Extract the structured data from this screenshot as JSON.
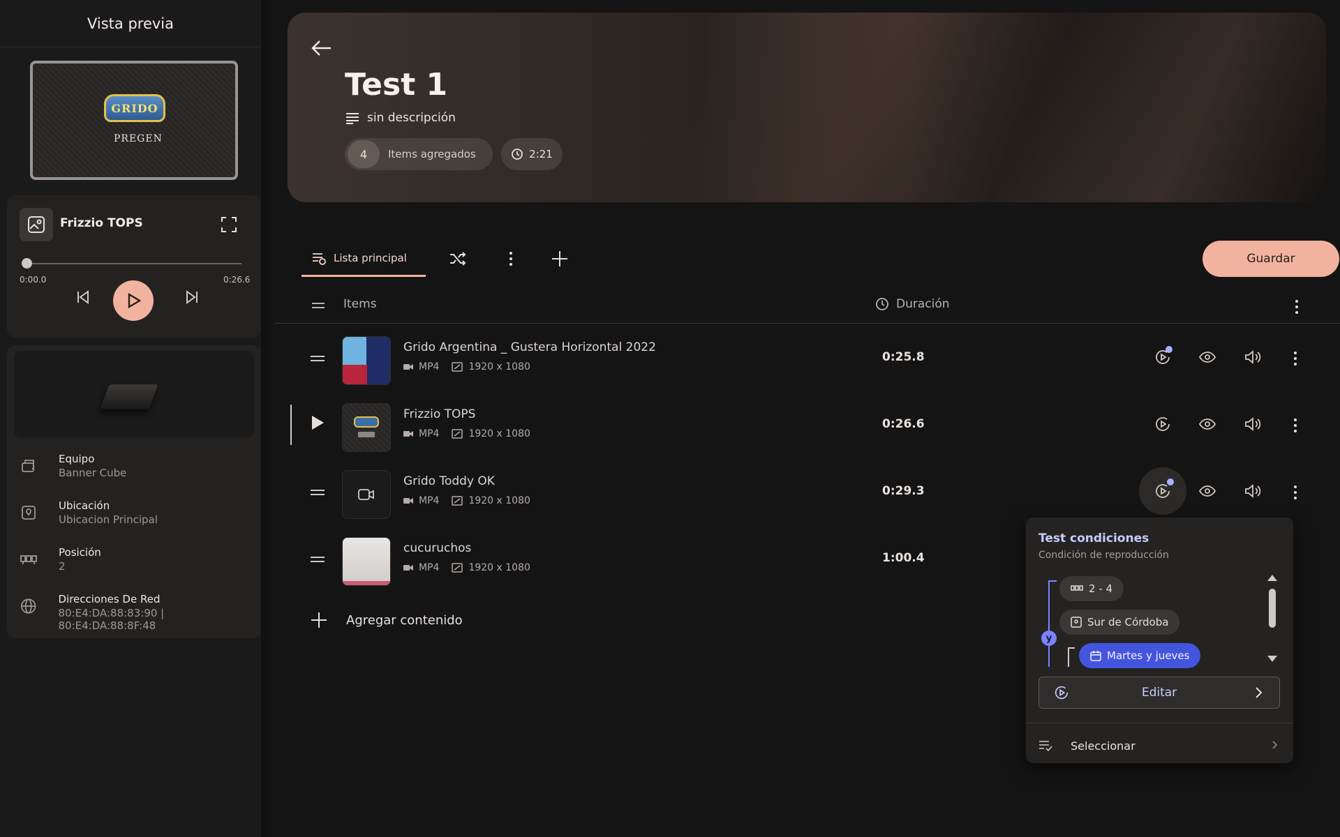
{
  "sidebar": {
    "title": "Vista previa",
    "preview": {
      "logo_text": "GRIDO",
      "logo_sub": "PREGEN"
    },
    "player": {
      "title": "Frizzio TOPS",
      "time_start": "0:00.0",
      "time_end": "0:26.6",
      "progress": 0.0
    },
    "device": {
      "items": [
        {
          "label": "Equipo",
          "value": "Banner Cube"
        },
        {
          "label": "Ubicación",
          "value": "Ubicacion Principal"
        },
        {
          "label": "Posición",
          "value": "2"
        },
        {
          "label": "Direcciones De Red",
          "value": "80:E4:DA:88:83:90 | 80:E4:DA:88:8F:48"
        }
      ]
    }
  },
  "hero": {
    "title": "Test 1",
    "description": "sin descripción",
    "items_count": "4",
    "items_label": "Items agregados",
    "total_time": "2:21"
  },
  "tabs": {
    "main_label": "Lista principal",
    "save_label": "Guardar"
  },
  "table": {
    "col_items": "Items",
    "col_duration": "Duración",
    "rows": [
      {
        "title": "Grido Argentina _ Gustera Horizontal 2022",
        "format": "MP4",
        "resolution": "1920 x 1080",
        "duration": "0:25.8"
      },
      {
        "title": "Frizzio TOPS",
        "format": "MP4",
        "resolution": "1920 x 1080",
        "duration": "0:26.6"
      },
      {
        "title": "Grido Toddy OK",
        "format": "MP4",
        "resolution": "1920 x 1080",
        "duration": "0:29.3"
      },
      {
        "title": "cucuruchos",
        "format": "MP4",
        "resolution": "1920 x 1080",
        "duration": "1:00.4"
      }
    ],
    "add_label": "Agregar contenido"
  },
  "popup": {
    "title": "Test condiciones",
    "subtitle": "Condición de reproducción",
    "conditions": [
      "2 - 4",
      "Sur de Córdoba",
      "Martes y jueves"
    ],
    "operator": "y",
    "edit_label": "Editar",
    "select_label": "Seleccionar"
  },
  "colors": {
    "accent": "#f1b39f",
    "condition_blue": "#4354dd",
    "condition_text": "#c7ccff"
  }
}
